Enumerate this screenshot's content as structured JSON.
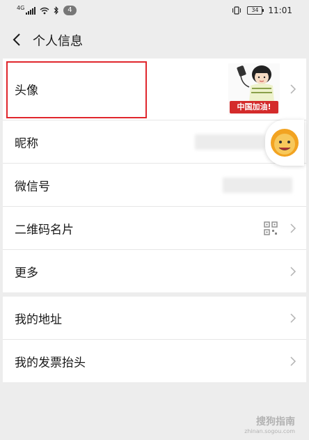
{
  "status_bar": {
    "network": "4G",
    "notification_count": "4",
    "battery": "34",
    "time": "11:01"
  },
  "nav": {
    "title": "个人信息"
  },
  "profile": {
    "avatar_label": "头像",
    "avatar_banner": "中国加油!",
    "nickname_label": "昵称",
    "wechat_id_label": "微信号",
    "qr_label": "二维码名片",
    "more_label": "更多"
  },
  "extra": {
    "address_label": "我的地址",
    "invoice_label": "我的发票抬头"
  },
  "watermark": {
    "logo": "搜狗指南",
    "url": "zhinan.sogou.com"
  },
  "colors": {
    "highlight": "#e0262c",
    "page_bg": "#ededed"
  }
}
